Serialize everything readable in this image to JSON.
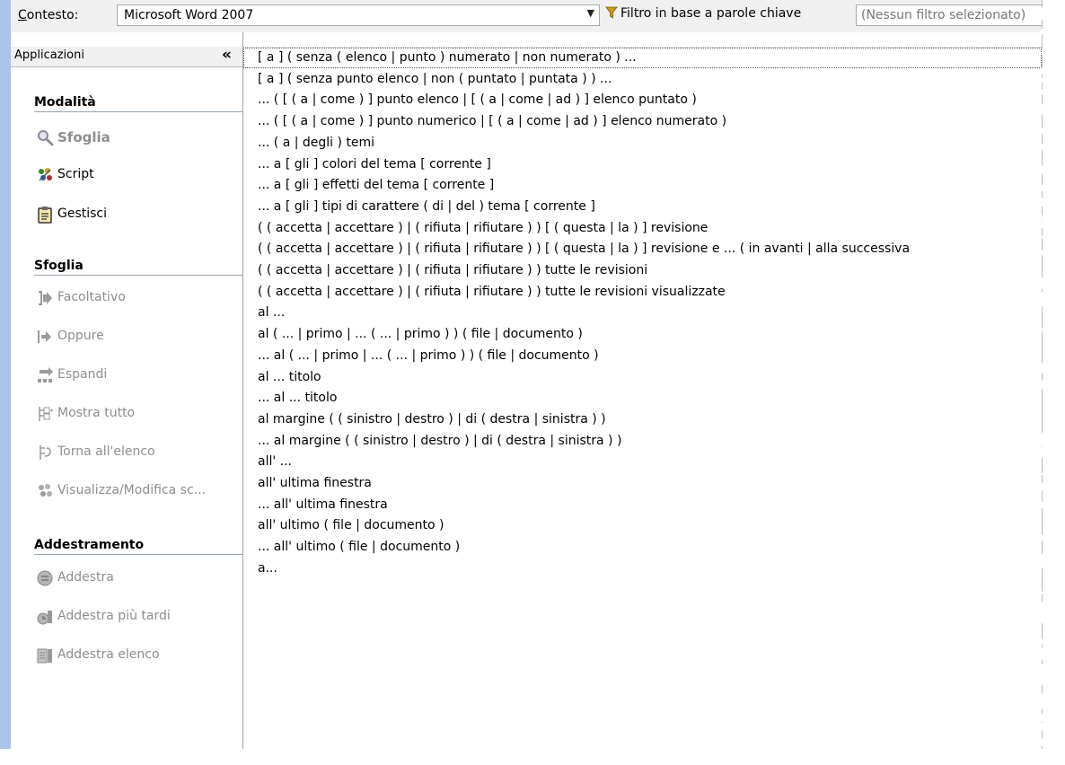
{
  "toolbar": {
    "context_label_u": "C",
    "context_label_rest": "ontesto:",
    "context_value": "Microsoft Word 2007",
    "filter_button_label": "Filtro in base a parole chiave",
    "filter_placeholder": "(Nessun filtro selezionato)"
  },
  "sidebar": {
    "header_title": "Applicazioni",
    "collapse_glyph": "«",
    "sections": [
      {
        "title": "Modalità",
        "items": [
          {
            "label": "Sfoglia",
            "icon": "magnifier-icon",
            "state": "selected"
          },
          {
            "label": "Script",
            "icon": "script-icon",
            "state": "enabled"
          },
          {
            "label": "Gestisci",
            "icon": "manage-icon",
            "state": "enabled"
          }
        ]
      },
      {
        "title": "Sfoglia",
        "items": [
          {
            "label": "Facoltativo",
            "icon": "optional-icon",
            "state": "disabled"
          },
          {
            "label": "Oppure",
            "icon": "arrow-right-icon",
            "state": "disabled"
          },
          {
            "label": "Espandi",
            "icon": "expand-icon",
            "state": "disabled"
          },
          {
            "label": "Mostra tutto",
            "icon": "show-all-icon",
            "state": "disabled"
          },
          {
            "label": "Torna all'elenco",
            "icon": "back-to-list-icon",
            "state": "disabled"
          },
          {
            "label": "Visualizza/Modifica sc...",
            "icon": "edit-script-icon",
            "state": "disabled"
          }
        ]
      },
      {
        "title": "Addestramento",
        "items": [
          {
            "label": "Addestra",
            "icon": "train-icon",
            "state": "disabled"
          },
          {
            "label": "Addestra più tardi",
            "icon": "train-later-icon",
            "state": "disabled"
          },
          {
            "label": "Addestra elenco",
            "icon": "train-list-icon",
            "state": "disabled"
          }
        ]
      }
    ]
  },
  "commands": [
    "[ a ] ( senza ( elenco | punto ) numerato | non numerato ) ...",
    "[ a ] ( senza punto elenco | non ( puntato | puntata ) ) ...",
    "... ( [ ( a | come ) ] punto elenco | [ ( a | come | ad ) ] elenco puntato )",
    "... ( [ ( a | come ) ] punto numerico | [ ( a | come | ad ) ] elenco numerato )",
    "... ( a | degli ) temi",
    "... a [ gli ] colori del tema [ corrente ]",
    "... a [ gli ] effetti del tema [ corrente ]",
    "... a [ gli ] tipi di carattere ( di | del ) tema [ corrente ]",
    "( ( accetta | accettare ) | ( rifiuta | rifiutare ) ) [ ( questa | la ) ] revisione",
    "( ( accetta | accettare ) | ( rifiuta | rifiutare ) ) [ ( questa | la ) ] revisione e ... ( in avanti | alla successiva",
    "( ( accetta | accettare ) | ( rifiuta | rifiutare ) ) tutte le revisioni",
    "( ( accetta | accettare ) | ( rifiuta | rifiutare ) ) tutte le revisioni visualizzate",
    "al ...",
    "al ( ... | primo | ... ( ... | primo ) ) ( file | documento )",
    "... al ( ... | primo | ... ( ... | primo ) ) ( file | documento )",
    "al ... titolo",
    "... al ... titolo",
    "al margine ( ( sinistro | destro ) | di ( destra | sinistra ) )",
    "... al margine ( ( sinistro | destro ) | di ( destra | sinistra ) )",
    "all' ...",
    "all' ultima finestra",
    "... all' ultima finestra",
    "all' ultimo ( file | documento )",
    "... all' ultimo ( file | documento )",
    "a..."
  ],
  "selected_index": 0
}
